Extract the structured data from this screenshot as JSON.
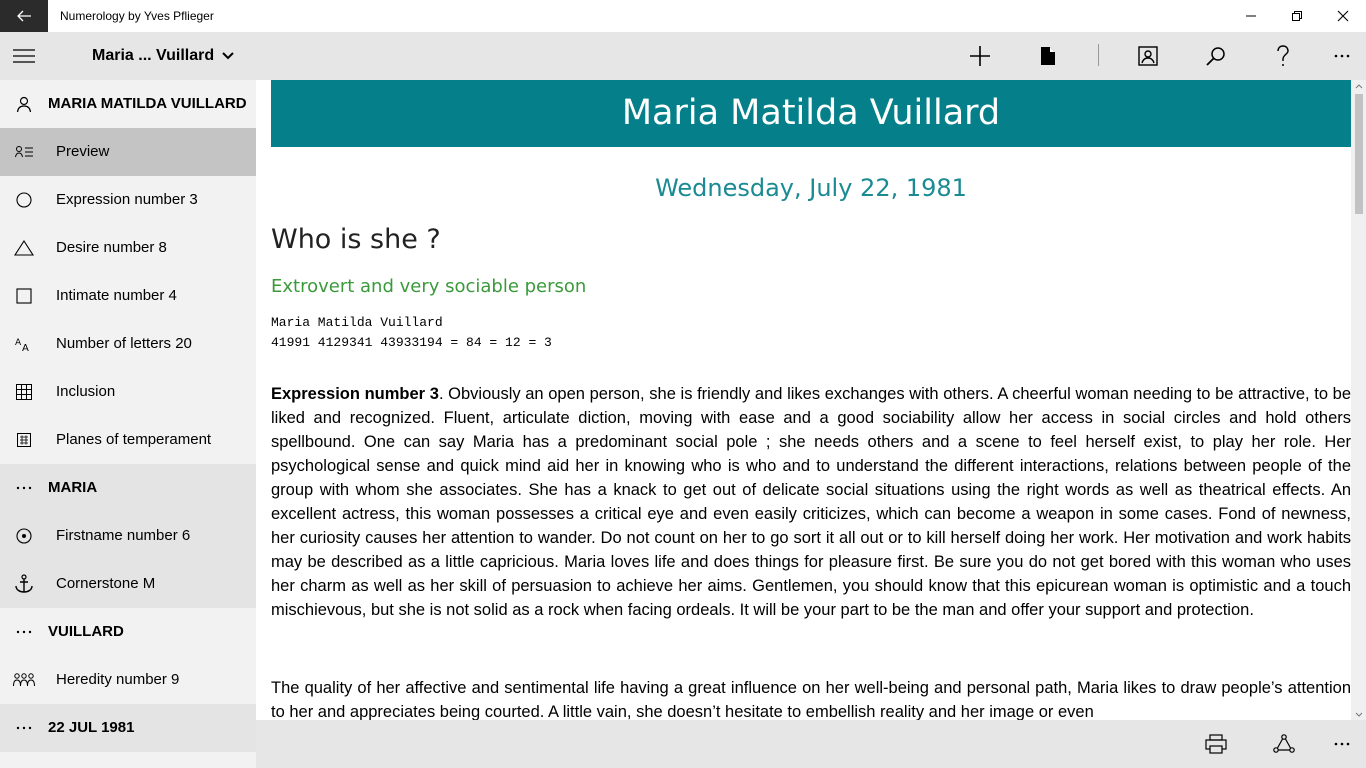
{
  "window": {
    "title": "Numerology by Yves Pflieger"
  },
  "command_bar": {
    "person_name": "Maria ... Vuillard"
  },
  "sidebar": {
    "items": [
      {
        "label": "MARIA MATILDA VUILLARD",
        "icon": "person-icon",
        "kind": "header"
      },
      {
        "label": "Preview",
        "icon": "preview-icon",
        "kind": "item",
        "selected": true
      },
      {
        "label": "Expression number 3",
        "icon": "circle-icon",
        "kind": "item"
      },
      {
        "label": "Desire number 8",
        "icon": "triangle-icon",
        "kind": "item"
      },
      {
        "label": "Intimate number 4",
        "icon": "square-icon",
        "kind": "item"
      },
      {
        "label": "Number of letters 20",
        "icon": "letters-icon",
        "kind": "item"
      },
      {
        "label": "Inclusion",
        "icon": "grid-icon",
        "kind": "item"
      },
      {
        "label": "Planes of temperament",
        "icon": "planes-icon",
        "kind": "item"
      },
      {
        "label": "MARIA",
        "icon": "more-icon",
        "kind": "group"
      },
      {
        "label": "Firstname number 6",
        "icon": "target-icon",
        "kind": "group-item"
      },
      {
        "label": "Cornerstone M",
        "icon": "anchor-icon",
        "kind": "group-item"
      },
      {
        "label": "VUILLARD",
        "icon": "more-icon",
        "kind": "header"
      },
      {
        "label": "Heredity number 9",
        "icon": "family-icon",
        "kind": "item"
      },
      {
        "label": "22 JUL 1981",
        "icon": "more-icon",
        "kind": "group"
      }
    ]
  },
  "content": {
    "banner_name": "Maria Matilda Vuillard",
    "date": "Wednesday, July 22, 1981",
    "heading": "Who is she ?",
    "subheading": "Extrovert and very sociable person",
    "calc_line1": "Maria Matilda Vuillard",
    "calc_line2": "41991 4129341 43933194 = 84 = 12 = 3",
    "para1_bold": "Expression number 3",
    "para1_text": ". Obviously an open person, she is friendly and likes exchanges with others. A cheerful woman needing to be attractive, to be liked and recognized. Fluent, articulate diction, moving with ease and a good sociability allow her access in social circles and hold others spellbound. One can say Maria has a predominant social pole ; she needs others and a scene to feel herself exist, to play her role. Her psychological sense and quick mind aid her in knowing who is who and to understand the different interactions, relations between people of the group with whom she associates. She has a knack to get out of delicate social situations using the right words as well as theatrical effects. An excellent actress, this woman possesses a critical eye and even easily criticizes, which can become a weapon in some cases. Fond of newness, her curiosity causes her attention to wander. Do not count on her to go sort it all out or to kill herself doing her work. Her motivation and work habits may be described as a little capricious. Maria loves life and does things for pleasure first. Be sure you do not get bored with this woman who uses her charm as well as her skill of persuasion to achieve her aims. Gentlemen, you should know that this epicurean woman is optimistic and a touch mischievous, but she is not solid as a rock when facing ordeals. It will be your part to be the man and offer your support and protection.",
    "para2_text": "The quality of her affective and sentimental life having a great influence on her well-being and personal path, Maria likes to draw people’s attention to her and appreciates being courted. A little vain, she doesn’t hesitate to embellish reality and her image or even"
  },
  "colors": {
    "banner": "#05808a",
    "date": "#1a8a93",
    "subheading": "#3a9a3a",
    "sidebar_bg": "#f2f2f2",
    "selected_bg": "#c4c4c4",
    "group_bg": "#e4e4e4",
    "bar_bg": "#e6e6e6"
  }
}
